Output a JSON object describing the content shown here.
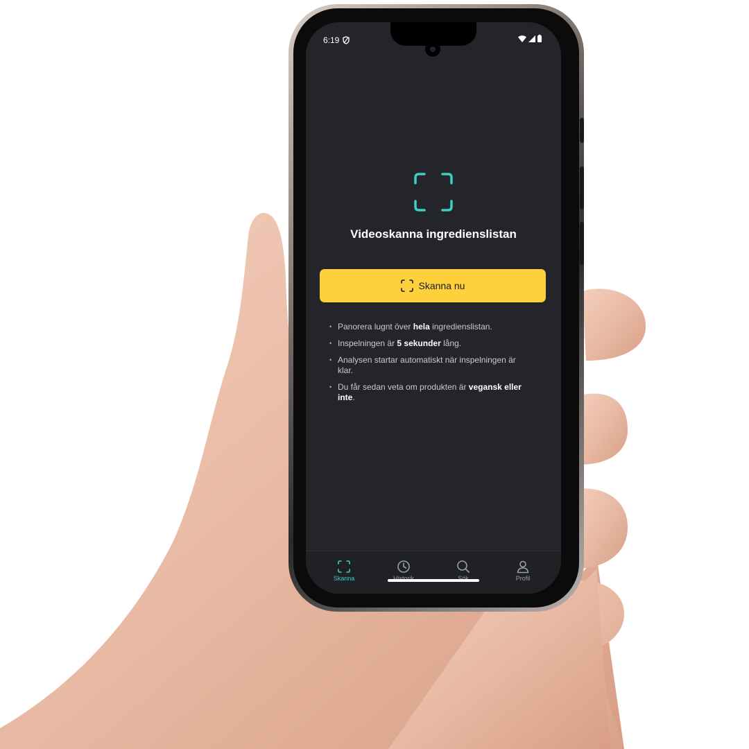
{
  "status_bar": {
    "time": "6:19"
  },
  "main": {
    "title": "Videoskanna ingredienslistan",
    "scan_button_label": "Skanna nu",
    "tips": [
      {
        "pre": "Panorera lugnt över ",
        "bold": "hela",
        "post": " ingredienslistan."
      },
      {
        "pre": "Inspelningen är ",
        "bold": "5 sekunder",
        "post": " lång."
      },
      {
        "pre": "Analysen startar automatiskt när inspelningen är klar.",
        "bold": "",
        "post": ""
      },
      {
        "pre": "Du får sedan veta om produkten är ",
        "bold": "vegansk eller inte",
        "post": "."
      }
    ]
  },
  "bottom_nav": {
    "items": [
      {
        "label": "Skanna",
        "icon": "scan-icon",
        "active": true
      },
      {
        "label": "Historik",
        "icon": "clock-icon",
        "active": false
      },
      {
        "label": "Sök",
        "icon": "search-icon",
        "active": false
      },
      {
        "label": "Profil",
        "icon": "person-icon",
        "active": false
      }
    ]
  },
  "colors": {
    "background": "#23252a",
    "accent_teal": "#3dcfc5",
    "button_yellow": "#fed03c"
  }
}
